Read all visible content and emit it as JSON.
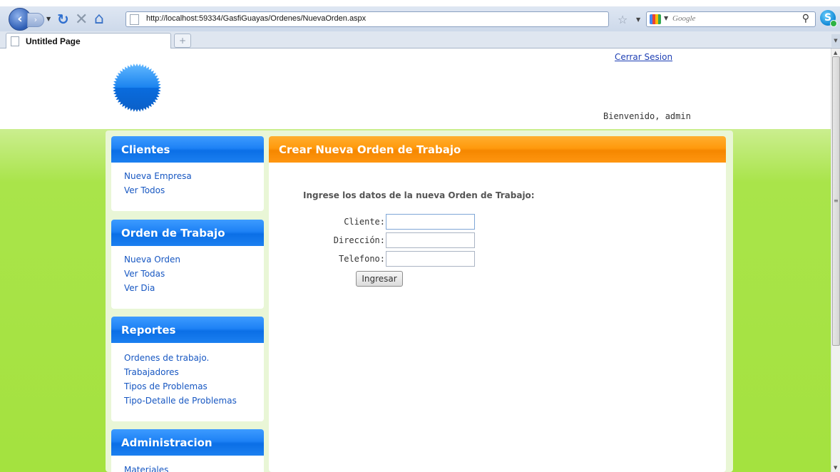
{
  "browser": {
    "address": "http://localhost:59334/GasfiGuayas/Ordenes/NuevaOrden.aspx",
    "search_placeholder": "Google",
    "tab_title": "Untitled Page",
    "new_tab_symbol": "+"
  },
  "header": {
    "logout_label": "Cerrar Sesion",
    "welcome": "Bienvenido, admin"
  },
  "sidebar": {
    "sections": [
      {
        "title": "Clientes",
        "items": [
          "Nueva Empresa",
          "Ver Todos"
        ]
      },
      {
        "title": "Orden de Trabajo",
        "items": [
          "Nueva Orden",
          "Ver Todas",
          "Ver Dia"
        ]
      },
      {
        "title": "Reportes",
        "items": [
          "Ordenes de trabajo.",
          "Trabajadores",
          "Tipos de Problemas",
          "Tipo-Detalle de Problemas"
        ]
      },
      {
        "title": "Administracion",
        "items": [
          "Materiales"
        ]
      }
    ]
  },
  "main": {
    "title": "Crear Nueva Orden de Trabajo",
    "intro": "Ingrese los datos de la nueva Orden de Trabajo:",
    "fields": {
      "cliente_label": "Cliente:",
      "cliente_value": "",
      "direccion_label": "Dirección:",
      "direccion_value": "",
      "telefono_label": "Telefono:",
      "telefono_value": ""
    },
    "submit_label": "Ingresar"
  },
  "colors": {
    "sidebar_header": "#1e82f5",
    "main_header": "#ff9a0d",
    "page_band": "#a9e44a",
    "link": "#1757c2"
  }
}
